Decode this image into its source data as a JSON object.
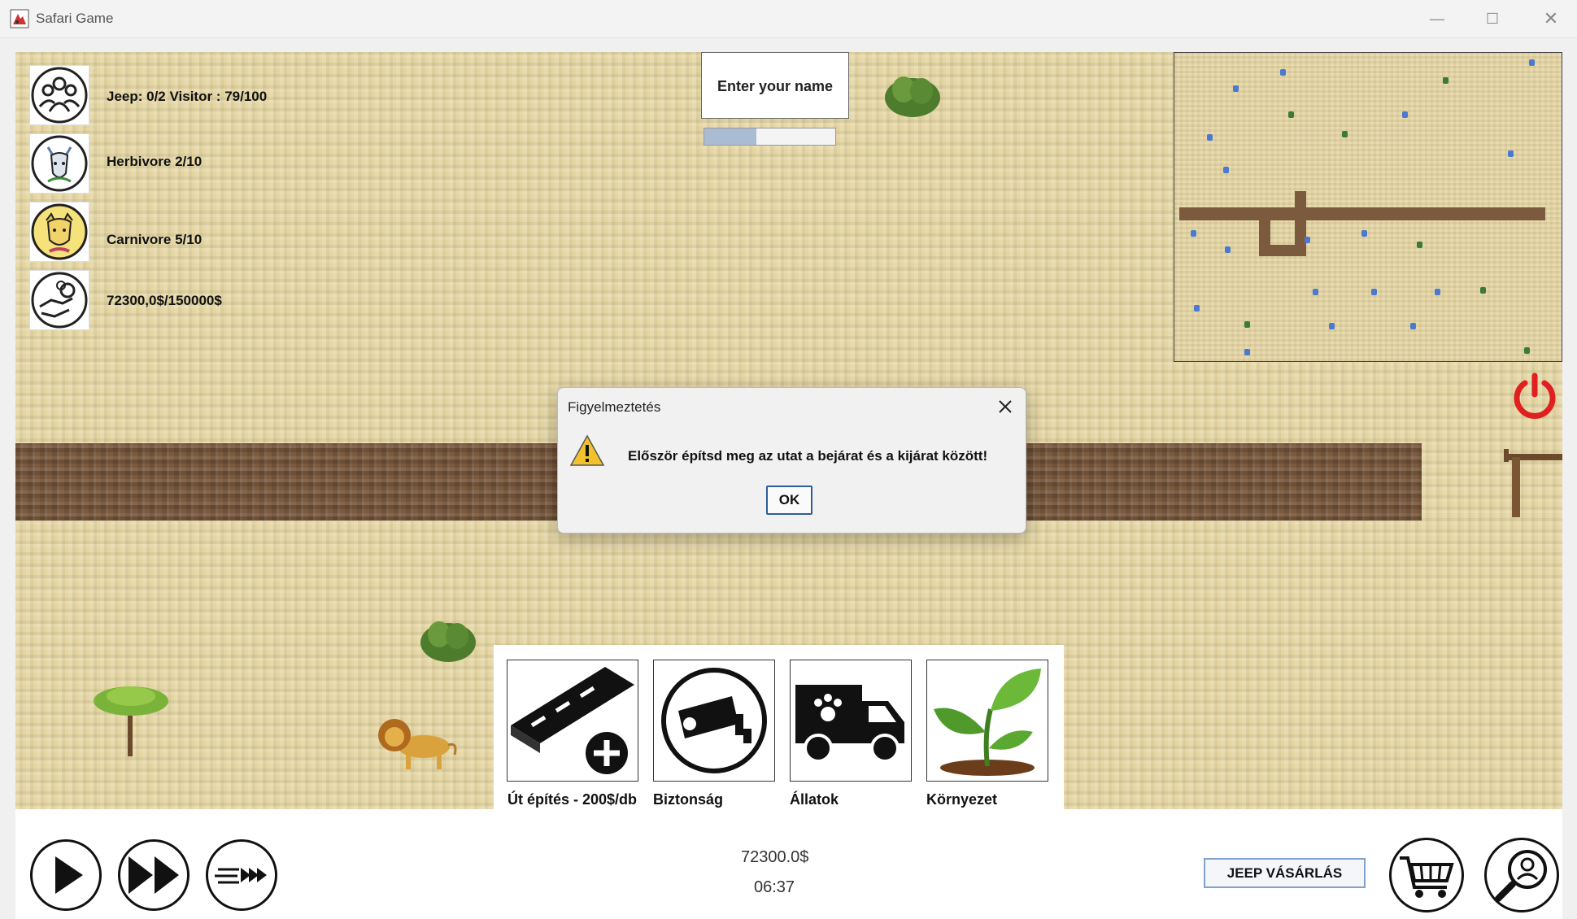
{
  "window": {
    "title": "Safari Game",
    "minimize_glyph": "—",
    "maximize_glyph": "☐",
    "close_glyph": "✕"
  },
  "stats": {
    "visitors": "Jeep: 0/2 Visitor : 79/100",
    "herbivore": "Herbivore 2/10",
    "carnivore": "Carnivore 5/10",
    "money": "72300,0$/150000$"
  },
  "name_input": {
    "label": "Enter your name",
    "progress": 0.4
  },
  "build_menu": {
    "road": "Út építés - 200$/db",
    "security": "Biztonság",
    "animals": "Állatok",
    "environment": "Környezet"
  },
  "status": {
    "money": "72300.0$",
    "time": "06:37"
  },
  "buttons": {
    "buy_jeep": "JEEP VÁSÁRLÁS"
  },
  "dialog": {
    "title": "Figyelmeztetés",
    "message": "Először építsd meg az utat a bejárat és a kijárat között!",
    "ok": "OK"
  },
  "colors": {
    "sand": "#e4d5a2",
    "road": "#7b5a3e",
    "power": "#e02020",
    "ok_border": "#2c5e9b"
  }
}
